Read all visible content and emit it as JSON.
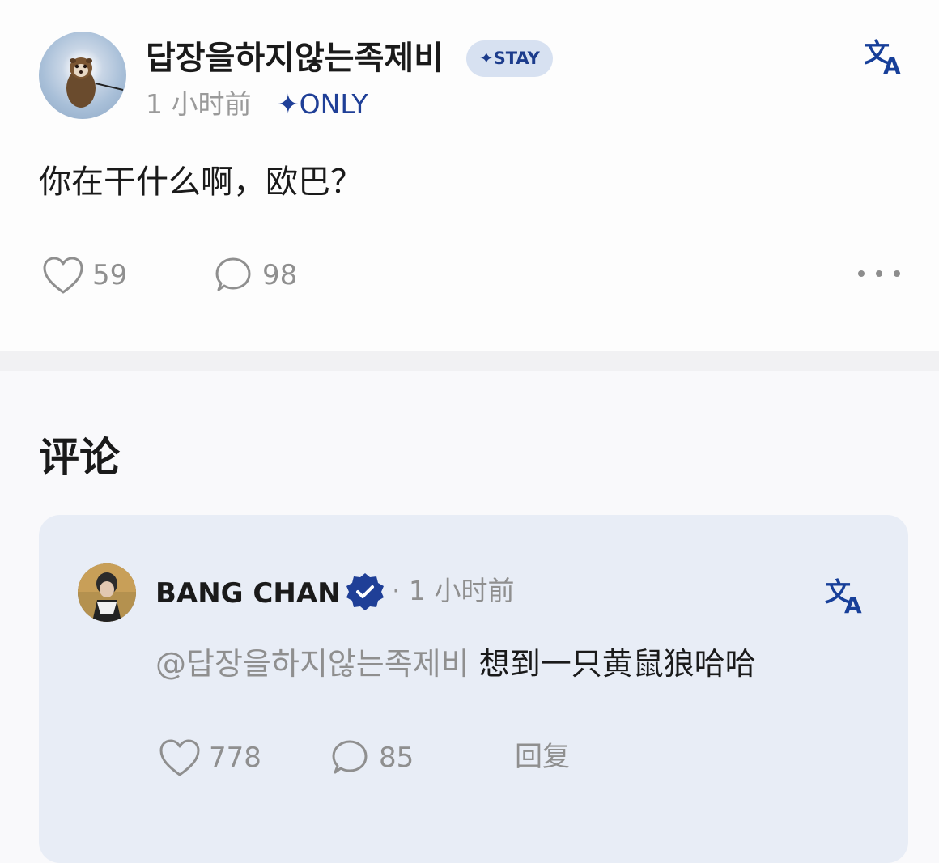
{
  "post": {
    "username": "답장을하지않는족제비",
    "badge": "STAY",
    "time": "1 小时前",
    "visibility": "ONLY",
    "content": "你在干什么啊，欧巴？",
    "likes": "59",
    "comments": "98"
  },
  "comments_section": {
    "title": "评论",
    "items": [
      {
        "author": "BANG CHAN",
        "time": "1 小时前",
        "mention": "@답장을하지않는족제비",
        "text": "想到一只黄鼠狼哈哈",
        "likes": "778",
        "replies": "85",
        "reply_label": "回复"
      }
    ]
  },
  "colors": {
    "accent": "#1f3f97",
    "badge_bg": "#d7e1f1",
    "card_bg": "#e8edf6",
    "muted_text": "#8f8f8f"
  },
  "icons": [
    "translate-icon",
    "heart-icon",
    "comment-bubble-icon",
    "more-options-icon",
    "verified-badge-icon",
    "sparkle-icon"
  ]
}
